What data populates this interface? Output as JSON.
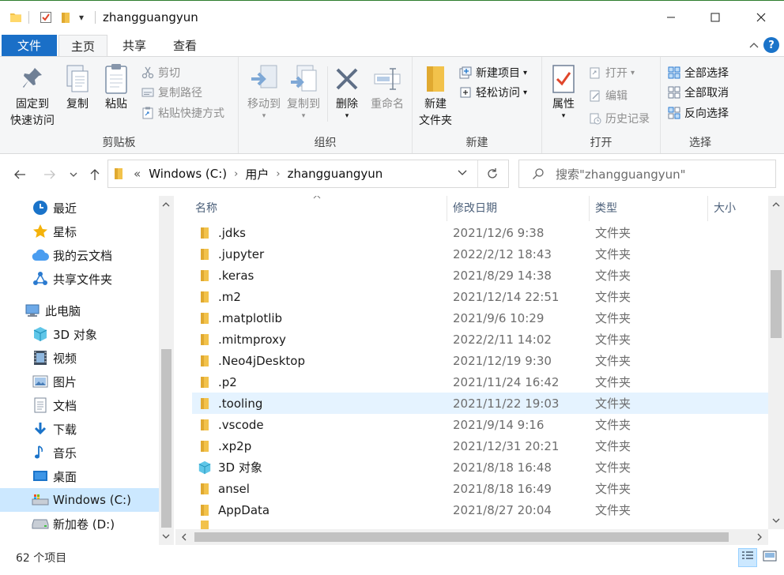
{
  "window": {
    "title": "zhangguangyun",
    "min_glyph": "—",
    "max_glyph": "☐",
    "close_glyph": "✕",
    "dropdown_glyph": "▾"
  },
  "tabs": {
    "file": "文件",
    "home": "主页",
    "share": "共享",
    "view": "查看",
    "collapse_glyph": "^",
    "help_glyph": "?"
  },
  "ribbon": {
    "clipboard": {
      "label": "剪贴板",
      "pin_line1": "固定到",
      "pin_line2": "快速访问",
      "copy": "复制",
      "paste": "粘贴",
      "cut": "剪切",
      "copy_path": "复制路径",
      "paste_shortcut": "粘贴快捷方式"
    },
    "organize": {
      "label": "组织",
      "move_to": "移动到",
      "copy_to": "复制到",
      "delete": "删除",
      "rename": "重命名"
    },
    "new": {
      "label": "新建",
      "new_folder_line1": "新建",
      "new_folder_line2": "文件夹",
      "new_item": "新建项目",
      "easy_access": "轻松访问"
    },
    "open": {
      "label": "打开",
      "properties": "属性",
      "open": "打开",
      "edit": "编辑",
      "history": "历史记录"
    },
    "select": {
      "label": "选择",
      "select_all": "全部选择",
      "select_none": "全部取消",
      "invert": "反向选择"
    }
  },
  "address": {
    "overflow": "«",
    "crumbs": [
      "Windows (C:)",
      "用户",
      "zhangguangyun"
    ],
    "search_placeholder": "搜索\"zhangguangyun\""
  },
  "nav_pane": {
    "items": [
      {
        "label": "最近",
        "icon": "clock-icon"
      },
      {
        "label": "星标",
        "icon": "star-icon"
      },
      {
        "label": "我的云文档",
        "icon": "cloud-icon"
      },
      {
        "label": "共享文件夹",
        "icon": "share-folder-icon"
      },
      {
        "label": "此电脑",
        "icon": "computer-icon"
      },
      {
        "label": "3D 对象",
        "icon": "3d-objects-icon"
      },
      {
        "label": "视频",
        "icon": "video-icon"
      },
      {
        "label": "图片",
        "icon": "pictures-icon"
      },
      {
        "label": "文档",
        "icon": "documents-icon"
      },
      {
        "label": "下载",
        "icon": "download-icon"
      },
      {
        "label": "音乐",
        "icon": "music-icon"
      },
      {
        "label": "桌面",
        "icon": "desktop-icon"
      },
      {
        "label": "Windows (C:)",
        "icon": "drive-c-icon",
        "selected": true
      },
      {
        "label": "新加卷 (D:)",
        "icon": "drive-d-icon"
      }
    ]
  },
  "file_list": {
    "columns": {
      "name": "名称",
      "modified": "修改日期",
      "type": "类型",
      "size": "大小"
    },
    "rows": [
      {
        "name": ".jdks",
        "modified": "2021/12/6 9:38",
        "type": "文件夹"
      },
      {
        "name": ".jupyter",
        "modified": "2022/2/12 18:43",
        "type": "文件夹"
      },
      {
        "name": ".keras",
        "modified": "2021/8/29 14:38",
        "type": "文件夹"
      },
      {
        "name": ".m2",
        "modified": "2021/12/14 22:51",
        "type": "文件夹"
      },
      {
        "name": ".matplotlib",
        "modified": "2021/9/6 10:29",
        "type": "文件夹"
      },
      {
        "name": ".mitmproxy",
        "modified": "2022/2/11 14:02",
        "type": "文件夹"
      },
      {
        "name": ".Neo4jDesktop",
        "modified": "2021/12/19 9:30",
        "type": "文件夹"
      },
      {
        "name": ".p2",
        "modified": "2021/11/24 16:42",
        "type": "文件夹"
      },
      {
        "name": ".tooling",
        "modified": "2021/11/22 19:03",
        "type": "文件夹",
        "hovered": true
      },
      {
        "name": ".vscode",
        "modified": "2021/9/14 9:16",
        "type": "文件夹"
      },
      {
        "name": ".xp2p",
        "modified": "2021/12/31 20:21",
        "type": "文件夹"
      },
      {
        "name": "3D 对象",
        "modified": "2021/8/18 16:48",
        "type": "文件夹",
        "icon": "3d-objects-icon"
      },
      {
        "name": "ansel",
        "modified": "2021/8/18 16:49",
        "type": "文件夹"
      },
      {
        "name": "AppData",
        "modified": "2021/8/27 20:04",
        "type": "文件夹"
      }
    ]
  },
  "status": {
    "item_count": "62 个项目"
  },
  "colors": {
    "file_tab": "#1a6fc7",
    "selection": "#cce8ff",
    "hover": "#e5f3ff",
    "folder": "#f2c24b",
    "accent_blue": "#1a73c9"
  }
}
